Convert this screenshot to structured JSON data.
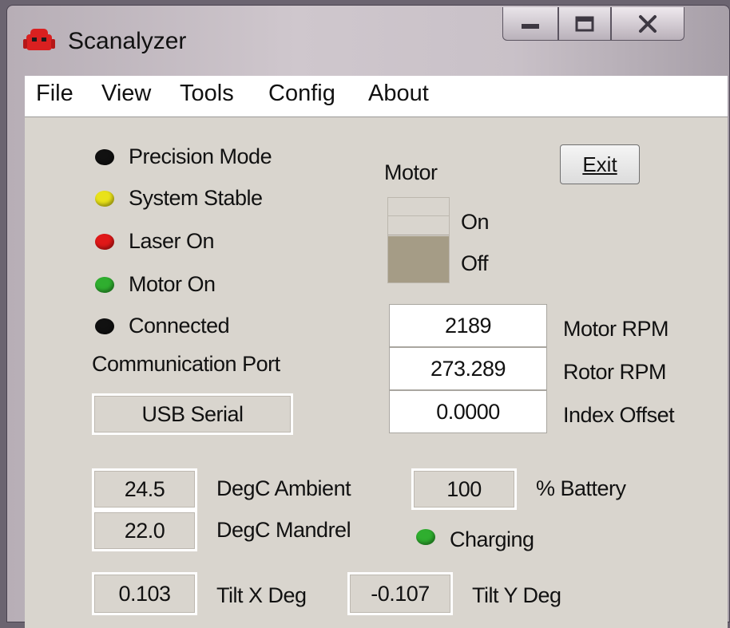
{
  "window": {
    "title": "Scanalyzer"
  },
  "menu": [
    "File",
    "View",
    "Tools",
    "Config",
    "About"
  ],
  "indicators": [
    {
      "label": "Precision Mode",
      "color": "#111111"
    },
    {
      "label": "System Stable",
      "color": "#e9e21a"
    },
    {
      "label": "Laser On",
      "color": "#e01818"
    },
    {
      "label": "Motor On",
      "color": "#2fae2f"
    },
    {
      "label": "Connected",
      "color": "#111111"
    }
  ],
  "communication": {
    "label": "Communication Port",
    "value": "USB Serial"
  },
  "motor": {
    "label": "Motor",
    "on_label": "On",
    "off_label": "Off",
    "state": "Off"
  },
  "exit_button": {
    "label": "Exit"
  },
  "readouts": [
    {
      "value": "2189",
      "label": "Motor RPM"
    },
    {
      "value": "273.289",
      "label": "Rotor RPM"
    },
    {
      "value": "0.0000",
      "label": "Index Offset"
    }
  ],
  "temperatures": [
    {
      "value": "24.5",
      "label": "DegC Ambient"
    },
    {
      "value": "22.0",
      "label": "DegC Mandrel"
    }
  ],
  "battery": {
    "value": "100",
    "label": "% Battery",
    "charging_label": "Charging",
    "charging_color": "#2fae2f"
  },
  "tilt": {
    "x": {
      "value": "0.103",
      "label": "Tilt X Deg"
    },
    "y": {
      "value": "-0.107",
      "label": "Tilt Y Deg"
    }
  }
}
